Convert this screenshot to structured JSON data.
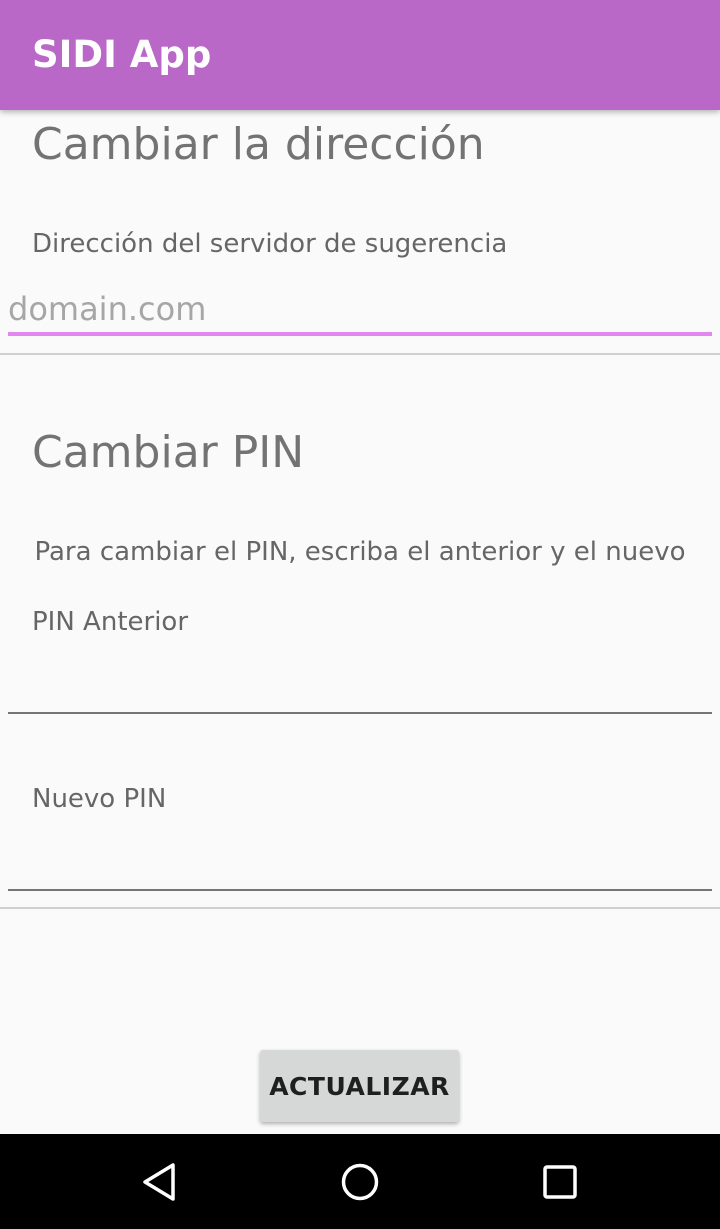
{
  "app_bar": {
    "title": "SIDI App",
    "color": "#ba68c8"
  },
  "address_section": {
    "title": "Cambiar la dirección",
    "label": "Dirección del servidor de sugerencia",
    "input_placeholder": "domain.com",
    "input_value": "",
    "focus_color": "#e387f0"
  },
  "pin_section": {
    "title": "Cambiar PIN",
    "hint": "Para cambiar el PIN, escriba el anterior y el nuevo",
    "old_pin_label": "PIN Anterior",
    "old_pin_value": "",
    "new_pin_label": "Nuevo PIN",
    "new_pin_value": ""
  },
  "actions": {
    "update_label": "ACTUALIZAR"
  },
  "nav_bar": {
    "back_icon": "back-triangle-icon",
    "home_icon": "home-circle-icon",
    "recents_icon": "recents-square-icon"
  }
}
